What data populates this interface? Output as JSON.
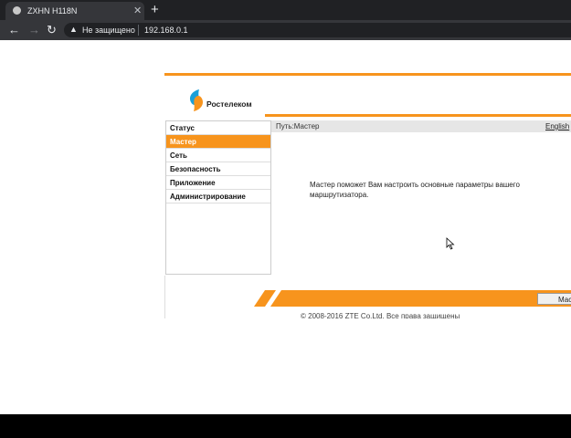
{
  "browser": {
    "tab_title": "ZXHN H118N",
    "tab_close": "✕",
    "new_tab": "+",
    "security_label": "Не защищено",
    "url": "192.168.0.1"
  },
  "header": {
    "logo_text": "Ростелеком",
    "brand_color": "#f7941d"
  },
  "sidebar": {
    "items": [
      {
        "label": "Статус"
      },
      {
        "label": "Мастер"
      },
      {
        "label": "Сеть"
      },
      {
        "label": "Безопасность"
      },
      {
        "label": "Приложение"
      },
      {
        "label": "Администрирование"
      }
    ],
    "active": "Мастер"
  },
  "main": {
    "path": "Путь:Мастер",
    "language_link": "English",
    "description": "Мастер поможет Вам настроить основные параметры вашего маршрутизатора."
  },
  "footer": {
    "button_label": "Мас",
    "copyright": "© 2008-2016 ZTE Co.Ltd. Все права защищены"
  }
}
